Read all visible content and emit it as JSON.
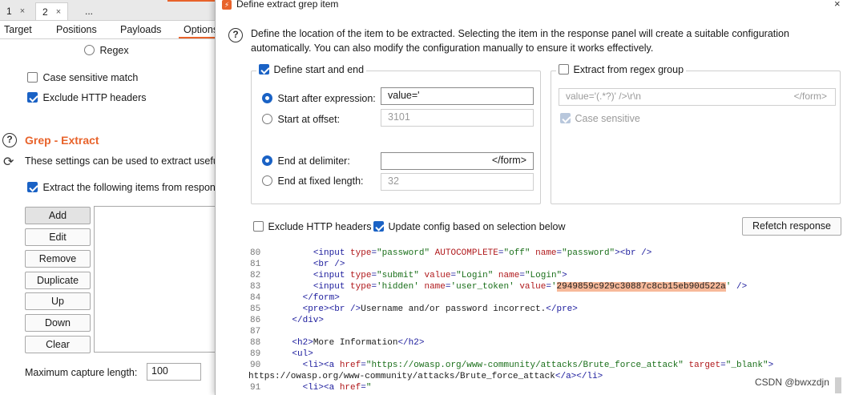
{
  "window_tabs": [
    {
      "label": "1",
      "close": "×"
    },
    {
      "label": "2",
      "close": "×"
    },
    {
      "label": "..."
    }
  ],
  "sub_tabs": [
    "Target",
    "Positions",
    "Payloads",
    "Options"
  ],
  "options": {
    "regex_label": "Regex",
    "case_sensitive_label": "Case sensitive match",
    "exclude_headers_label": "Exclude HTTP headers"
  },
  "grep_extract": {
    "title": "Grep - Extract",
    "description": "These settings can be used to extract useful information from responses",
    "extract_label": "Extract the following items from responses:",
    "buttons": [
      "Add",
      "Edit",
      "Remove",
      "Duplicate",
      "Up",
      "Down",
      "Clear"
    ],
    "max_capture_label": "Maximum capture length:",
    "max_capture_value": "100"
  },
  "dialog": {
    "title": "Define extract grep item",
    "close": "×",
    "description": "Define the location of the item to be extracted. Selecting the item in the response panel will create a suitable configuration automatically. You can also modify the configuration manually to ensure it works effectively.",
    "define_start_end_label": "Define start and end",
    "start_after_label": "Start after expression:",
    "start_after_value": "value='",
    "start_offset_label": "Start at offset:",
    "start_offset_value": "3101",
    "end_delim_label": "End at delimiter:",
    "end_delim_value": "</form>",
    "end_fixed_label": "End at fixed length:",
    "end_fixed_value": "32",
    "extract_regex_label": "Extract from regex group",
    "regex_left": "value='(.*?)' />\\r\\n",
    "regex_right": "</form>",
    "case_sensitive_label": "Case sensitive",
    "exclude_headers_label": "Exclude HTTP headers",
    "update_config_label": "Update config based on selection below",
    "refetch_label": "Refetch response"
  },
  "code_lines": [
    {
      "n": "80",
      "pre": "        ",
      "parts": [
        [
          "t",
          "<input "
        ],
        [
          "a",
          "type"
        ],
        [
          "t",
          "="
        ],
        [
          "v",
          "\"password\""
        ],
        [
          "t",
          " "
        ],
        [
          "a",
          "AUTOCOMPLETE"
        ],
        [
          "t",
          "="
        ],
        [
          "v",
          "\"off\""
        ],
        [
          "t",
          " "
        ],
        [
          "a",
          "name"
        ],
        [
          "t",
          "="
        ],
        [
          "v",
          "\"password\""
        ],
        [
          "t",
          "><br />"
        ]
      ]
    },
    {
      "n": "81",
      "pre": "        ",
      "parts": [
        [
          "t",
          "<br />"
        ]
      ]
    },
    {
      "n": "82",
      "pre": "        ",
      "parts": [
        [
          "t",
          "<input "
        ],
        [
          "a",
          "type"
        ],
        [
          "t",
          "="
        ],
        [
          "v",
          "\"submit\""
        ],
        [
          "t",
          " "
        ],
        [
          "a",
          "value"
        ],
        [
          "t",
          "="
        ],
        [
          "v",
          "\"Login\""
        ],
        [
          "t",
          " "
        ],
        [
          "a",
          "name"
        ],
        [
          "t",
          "="
        ],
        [
          "v",
          "\"Login\""
        ],
        [
          "t",
          ">"
        ]
      ]
    },
    {
      "n": "83",
      "pre": "        ",
      "parts": [
        [
          "t",
          "<input "
        ],
        [
          "a",
          "type"
        ],
        [
          "t",
          "="
        ],
        [
          "v",
          "'hidden'"
        ],
        [
          "t",
          " "
        ],
        [
          "a",
          "name"
        ],
        [
          "t",
          "="
        ],
        [
          "v",
          "'user_token'"
        ],
        [
          "t",
          " "
        ],
        [
          "a",
          "value"
        ],
        [
          "t",
          "="
        ],
        [
          "v",
          "'"
        ],
        [
          "hl",
          "2949859c929c30887c8cb15eb90d522a"
        ],
        [
          "v",
          "'"
        ],
        [
          "t",
          " />"
        ]
      ]
    },
    {
      "n": "84",
      "pre": "      ",
      "parts": [
        [
          "t",
          "</form>"
        ]
      ]
    },
    {
      "n": "85",
      "pre": "      ",
      "parts": [
        [
          "t",
          "<pre><br />"
        ],
        [
          "x",
          "Username and/or password incorrect."
        ],
        [
          "t",
          "</pre>"
        ]
      ]
    },
    {
      "n": "86",
      "pre": "    ",
      "parts": [
        [
          "t",
          "</div>"
        ]
      ]
    },
    {
      "n": "87",
      "pre": "",
      "parts": []
    },
    {
      "n": "88",
      "pre": "    ",
      "parts": [
        [
          "t",
          "<h2>"
        ],
        [
          "x",
          "More Information"
        ],
        [
          "t",
          "</h2>"
        ]
      ]
    },
    {
      "n": "89",
      "pre": "    ",
      "parts": [
        [
          "t",
          "<ul>"
        ]
      ]
    },
    {
      "n": "90",
      "pre": "      ",
      "parts": [
        [
          "t",
          "<li><a "
        ],
        [
          "a",
          "href"
        ],
        [
          "t",
          "="
        ],
        [
          "v",
          "\"https://owasp.org/www-community/attacks/Brute_force_attack\""
        ],
        [
          "t",
          " "
        ],
        [
          "a",
          "target"
        ],
        [
          "t",
          "="
        ],
        [
          "v",
          "\"_blank\""
        ],
        [
          "t",
          ">"
        ]
      ]
    },
    {
      "n": "",
      "pre": "",
      "parts": [
        [
          "x",
          "https://owasp.org/www-community/attacks/Brute_force_attack"
        ],
        [
          "t",
          "</a></li>"
        ]
      ]
    },
    {
      "n": "91",
      "pre": "      ",
      "parts": [
        [
          "t",
          "<li><a "
        ],
        [
          "a",
          "href"
        ],
        [
          "t",
          "="
        ],
        [
          "v",
          "\""
        ]
      ]
    }
  ],
  "watermark": "CSDN @bwxzdjn",
  "colors": {
    "accent": "#e8632b",
    "check_blue": "#1a62c5",
    "highlight": "#f7b99a"
  }
}
